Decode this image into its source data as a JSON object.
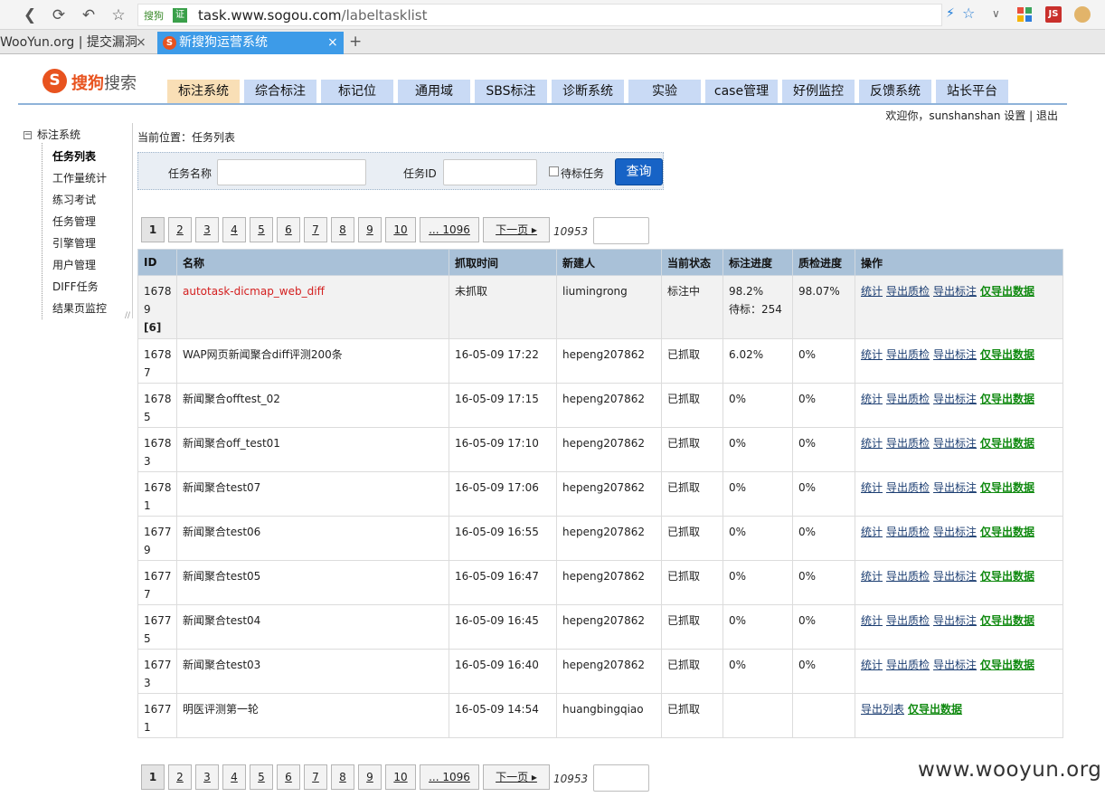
{
  "browser": {
    "url_host": "task.www.sogou.com",
    "url_path": "/labeltasklist",
    "site_chip": "搜狗",
    "cert_chip": "证",
    "tabs": [
      {
        "label": "WooYun.org | 提交漏洞",
        "active": false
      },
      {
        "label": "新搜狗运营系统",
        "active": true
      }
    ],
    "new_tab": "+",
    "close": "×",
    "ext_js": "JS"
  },
  "header": {
    "logo_mark": "S",
    "logo_text_1": "搜狗",
    "logo_text_2": "搜索",
    "menu": [
      "标注系统",
      "综合标注",
      "标记位",
      "通用域",
      "SBS标注",
      "诊断系统",
      "实验",
      "case管理",
      "好例监控",
      "反馈系统",
      "站长平台"
    ],
    "welcome_prefix": "欢迎你，sunshanshan",
    "settings": "设置",
    "sep": "|",
    "logout": "退出"
  },
  "sidebar": {
    "toggle": "−",
    "root": "标注系统",
    "items": [
      "任务列表",
      "工作量统计",
      "练习考试",
      "任务管理",
      "引擎管理",
      "用户管理",
      "DIFF任务",
      "结果页监控"
    ]
  },
  "content": {
    "breadcrumb": "当前位置：任务列表",
    "search": {
      "name_label": "任务名称",
      "id_label": "任务ID",
      "pending_label": "待标任务",
      "query_button": "查询"
    },
    "pager": {
      "pages": [
        "1",
        "2",
        "3",
        "4",
        "5",
        "6",
        "7",
        "8",
        "9",
        "10"
      ],
      "ellipsis": "... 1096",
      "next": "下一页 ▸",
      "total": "10953"
    },
    "table": {
      "headers": [
        "ID",
        "名称",
        "抓取时间",
        "新建人",
        "当前状态",
        "标注进度",
        "质检进度",
        "操作"
      ],
      "rows": [
        {
          "id": "16789",
          "badge": "[6]",
          "name": "autotask-dicmap_web_diff",
          "time": "未抓取",
          "creator": "liumingrong",
          "status": "标注中",
          "label_progress": "98.2%",
          "label_pending": "待标：254",
          "qc_progress": "98.07%"
        },
        {
          "id": "16787",
          "name": "WAP网页新闻聚合diff评测200条",
          "time": "16-05-09 17:22",
          "creator": "hepeng207862",
          "status": "已抓取",
          "label_progress": "6.02%",
          "qc_progress": "0%"
        },
        {
          "id": "16785",
          "name": "新闻聚合offtest_02",
          "time": "16-05-09 17:15",
          "creator": "hepeng207862",
          "status": "已抓取",
          "label_progress": "0%",
          "qc_progress": "0%"
        },
        {
          "id": "16783",
          "name": "新闻聚合off_test01",
          "time": "16-05-09 17:10",
          "creator": "hepeng207862",
          "status": "已抓取",
          "label_progress": "0%",
          "qc_progress": "0%"
        },
        {
          "id": "16781",
          "name": "新闻聚合test07",
          "time": "16-05-09 17:06",
          "creator": "hepeng207862",
          "status": "已抓取",
          "label_progress": "0%",
          "qc_progress": "0%"
        },
        {
          "id": "16779",
          "name": "新闻聚合test06",
          "time": "16-05-09 16:55",
          "creator": "hepeng207862",
          "status": "已抓取",
          "label_progress": "0%",
          "qc_progress": "0%"
        },
        {
          "id": "16777",
          "name": "新闻聚合test05",
          "time": "16-05-09 16:47",
          "creator": "hepeng207862",
          "status": "已抓取",
          "label_progress": "0%",
          "qc_progress": "0%"
        },
        {
          "id": "16775",
          "name": "新闻聚合test04",
          "time": "16-05-09 16:45",
          "creator": "hepeng207862",
          "status": "已抓取",
          "label_progress": "0%",
          "qc_progress": "0%"
        },
        {
          "id": "16773",
          "name": "新闻聚合test03",
          "time": "16-05-09 16:40",
          "creator": "hepeng207862",
          "status": "已抓取",
          "label_progress": "0%",
          "qc_progress": "0%"
        },
        {
          "id": "16771",
          "name": "明医评测第一轮",
          "time": "16-05-09 14:54",
          "creator": "huangbingqiao",
          "status": "已抓取",
          "label_progress": "",
          "qc_progress": ""
        }
      ],
      "ops_standard": [
        "统计",
        "导出质检",
        "导出标注",
        "仅导出数据"
      ],
      "ops_last": [
        "导出列表",
        "仅导出数据"
      ]
    }
  },
  "watermark": "www.wooyun.org",
  "colors": {
    "accent": "#1763c6",
    "menu": "#c9daf5",
    "menu_current": "#f9dfb6",
    "table_header": "#a9c1d8",
    "red_name": "#d42020",
    "green_link": "#118a11"
  }
}
